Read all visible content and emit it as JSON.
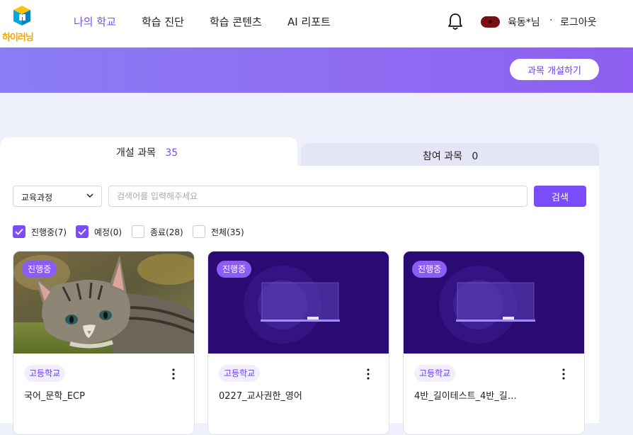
{
  "header": {
    "logo_text": "하이러닝",
    "nav": [
      {
        "label": "나의 학교",
        "active": true
      },
      {
        "label": "학습 진단",
        "active": false
      },
      {
        "label": "학습 콘텐츠",
        "active": false
      },
      {
        "label": "AI 리포트",
        "active": false
      }
    ],
    "user_name": "육동*님",
    "separator": "·",
    "logout_label": "로그아웃"
  },
  "banner": {
    "open_course_label": "과목 개설하기"
  },
  "tabs": [
    {
      "label": "개설 과목",
      "count": "35",
      "active": true
    },
    {
      "label": "참여 과목",
      "count": "0",
      "active": false
    }
  ],
  "filter": {
    "curriculum_selected": "교육과정",
    "search_placeholder": "검색어를 입력해주세요",
    "search_label": "검색"
  },
  "status_filters": [
    {
      "label": "진행중(7)",
      "checked": true
    },
    {
      "label": "예정(0)",
      "checked": true
    },
    {
      "label": "종료(28)",
      "checked": false
    },
    {
      "label": "전체(35)",
      "checked": false
    }
  ],
  "courses": [
    {
      "status": "진행중",
      "school": "고등학교",
      "title": "국어_문학_ECP",
      "thumbnail": "cat-photo"
    },
    {
      "status": "진행중",
      "school": "고등학교",
      "title": "0227_교사권한_영어",
      "thumbnail": "classroom-illustration"
    },
    {
      "status": "진행중",
      "school": "고등학교",
      "title": "4반_길이테스트_4반_길…",
      "thumbnail": "classroom-illustration"
    }
  ],
  "colors": {
    "accent": "#7b4dfa",
    "banner": "#8f6bf2",
    "thumb_purple": "#2a0a73",
    "background": "#eef0fb"
  },
  "icons": {
    "bell": "bell-icon",
    "chevron": "chevron-down-icon",
    "more": "more-vertical-icon",
    "check": "check-icon"
  }
}
